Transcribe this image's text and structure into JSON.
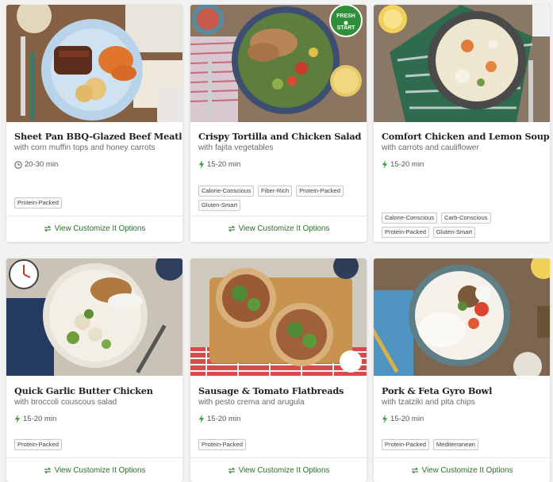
{
  "recipes": [
    {
      "title": "Sheet Pan BBQ-Glazed Beef Meatloaf",
      "subtitle": "with corn muffin tops and honey carrots",
      "time": "20-30 min",
      "time_icon": "clock-icon",
      "tags": [
        "Protein-Packed"
      ],
      "cta": "View Customize It Options"
    },
    {
      "title": "Crispy Tortilla and Chicken Salad",
      "subtitle": "with fajita vegetables",
      "time": "15-20 min",
      "time_icon": "lightning-icon",
      "badge": {
        "line1": "FRESH",
        "line2": "START"
      },
      "tags": [
        "Calorie-Conscious",
        "Fiber-Rich",
        "Protein-Packed",
        "Gluten-Smart"
      ],
      "cta": "View Customize It Options"
    },
    {
      "title": "Comfort Chicken and Lemon Soup",
      "subtitle": "with carrots and cauliflower",
      "time": "15-20 min",
      "time_icon": "lightning-icon",
      "tags": [
        "Calorie-Conscious",
        "Carb-Conscious",
        "Protein-Packed",
        "Gluten-Smart"
      ],
      "cta": "View Customize It Options"
    },
    {
      "title": "Quick Garlic Butter Chicken",
      "subtitle": "with broccoli couscous salad",
      "time": "15-20 min",
      "time_icon": "lightning-icon",
      "tags": [
        "Protein-Packed"
      ],
      "cta": "View Customize It Options"
    },
    {
      "title": "Sausage & Tomato Flatbreads",
      "subtitle": "with pesto crema and arugula",
      "time": "15-20 min",
      "time_icon": "lightning-icon",
      "tags": [
        "Protein-Packed"
      ],
      "cta": "View Customize It Options"
    },
    {
      "title": "Pork & Feta Gyro Bowl",
      "subtitle": "with tzatziki and pita chips",
      "time": "15-20 min",
      "time_icon": "lightning-icon",
      "tags": [
        "Protein-Packed",
        "Mediterranean"
      ],
      "cta": "View Customize It Options"
    }
  ],
  "colors": {
    "accent_green": "#2b6d2b",
    "lightning_green": "#3a9a3a",
    "badge_green": "#2f8f3a"
  }
}
